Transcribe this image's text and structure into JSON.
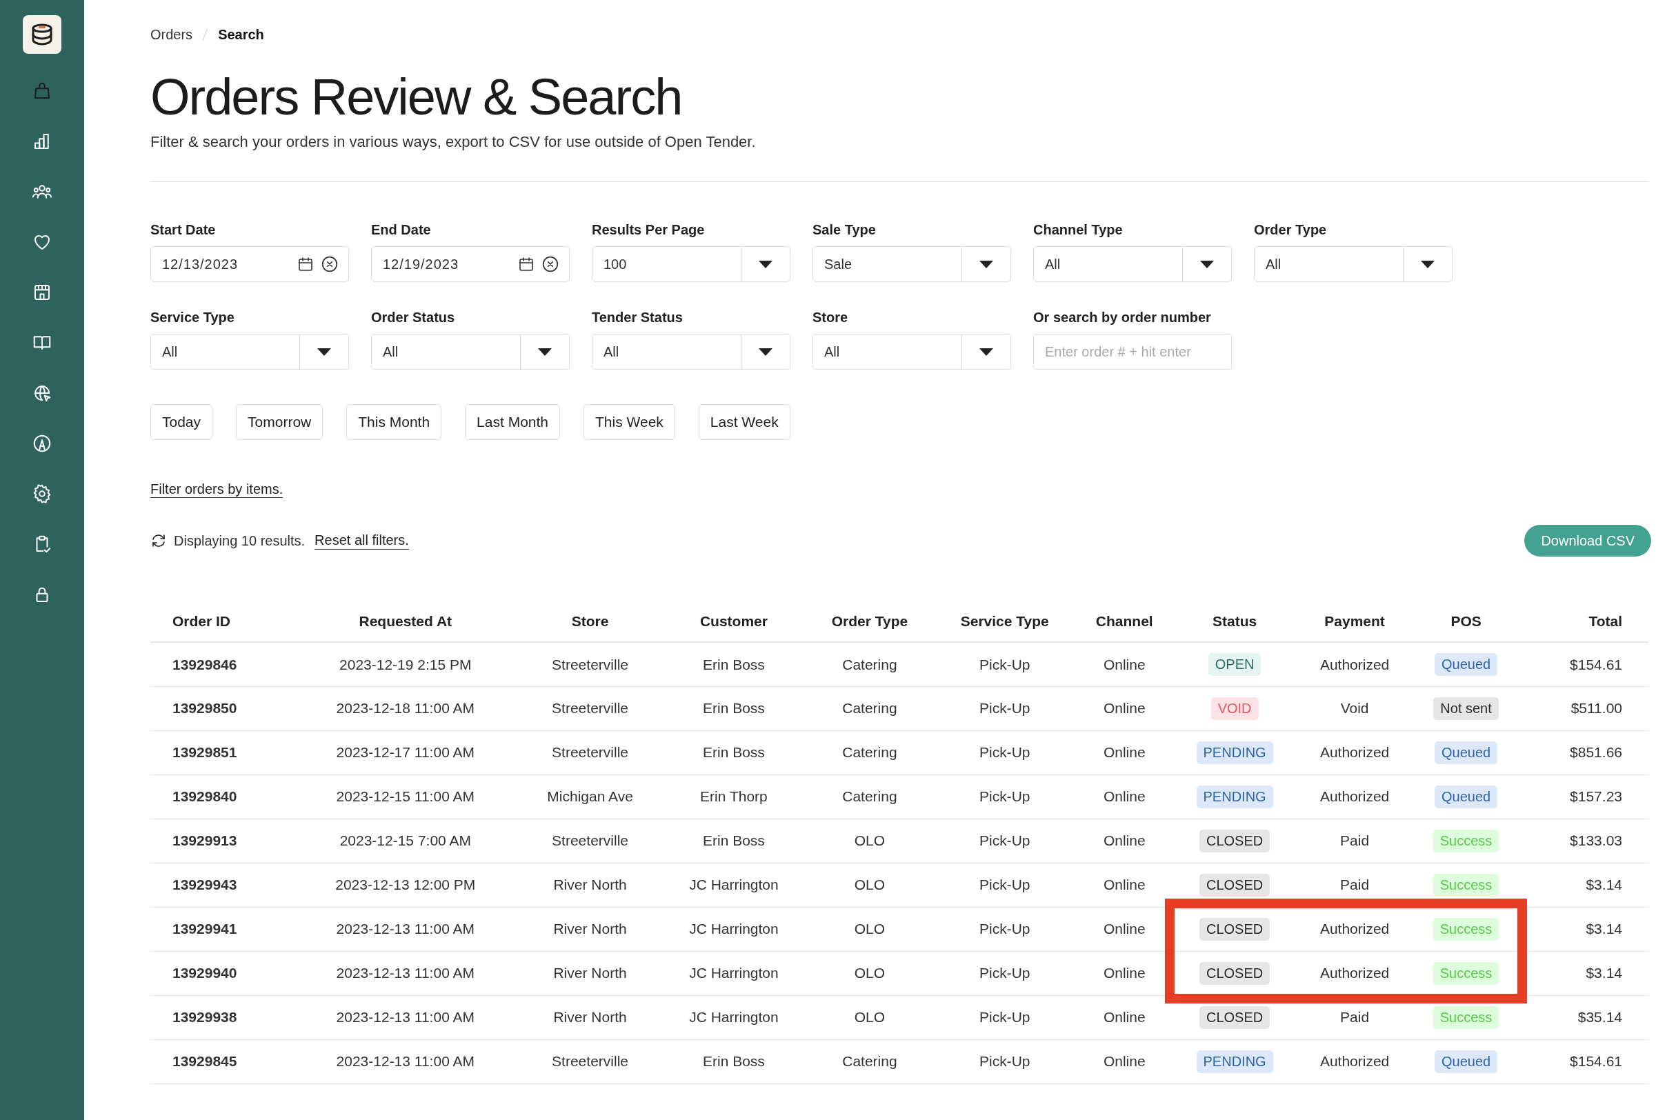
{
  "sidebar": {
    "items": [
      {
        "selected": false
      },
      {
        "selected": false
      },
      {
        "selected": false
      },
      {
        "selected": false
      },
      {
        "selected": false
      },
      {
        "selected": false
      },
      {
        "selected": false
      },
      {
        "selected": false
      },
      {
        "selected": false
      },
      {
        "selected": false
      },
      {
        "selected": false
      }
    ]
  },
  "breadcrumb": [
    {
      "label": "Orders",
      "current": false
    },
    {
      "label": "Search",
      "current": true
    }
  ],
  "title": "Orders Review & Search",
  "subtitle": "Filter & search your orders in various ways, export to CSV for use outside of Open Tender.",
  "filters": [
    {
      "kind": "date",
      "label": "Start Date",
      "value": "12/13/2023"
    },
    {
      "kind": "date",
      "label": "End Date",
      "value": "12/19/2023"
    },
    {
      "kind": "select",
      "label": "Results Per Page",
      "value": "100"
    },
    {
      "kind": "select",
      "label": "Sale Type",
      "value": "Sale"
    },
    {
      "kind": "select",
      "label": "Channel Type",
      "value": "All"
    },
    {
      "kind": "select",
      "label": "Order Type",
      "value": "All"
    },
    {
      "kind": "select",
      "label": "Service Type",
      "value": "All"
    },
    {
      "kind": "select",
      "label": "Order Status",
      "value": "All"
    },
    {
      "kind": "select",
      "label": "Tender Status",
      "value": "All"
    },
    {
      "kind": "select",
      "label": "Store",
      "value": "All"
    },
    {
      "kind": "text",
      "label": "Or search by order number",
      "placeholder": "Enter order # + hit enter"
    }
  ],
  "quick_ranges": [
    "Today",
    "Tomorrow",
    "This Month",
    "Last Month",
    "This Week",
    "Last Week"
  ],
  "filter_by_items_link": "Filter orders by items.",
  "results_text": "Displaying 10 results.",
  "reset_link": "Reset all filters.",
  "download_button": "Download CSV",
  "table": {
    "columns": [
      "Order ID",
      "Requested At",
      "Store",
      "Customer",
      "Order Type",
      "Service Type",
      "Channel",
      "Status",
      "Payment",
      "POS",
      "Total"
    ],
    "rows": [
      {
        "cells": [
          "13929846",
          "2023-12-19 2:15 PM",
          "Streeterville",
          "Erin Boss",
          "Catering",
          "Pick-Up",
          "Online"
        ],
        "status": {
          "text": "OPEN",
          "kind": "open"
        },
        "payment": "Authorized",
        "pos": {
          "text": "Queued",
          "kind": "queued"
        },
        "total": "$154.61",
        "highlighted": false
      },
      {
        "cells": [
          "13929850",
          "2023-12-18 11:00 AM",
          "Streeterville",
          "Erin Boss",
          "Catering",
          "Pick-Up",
          "Online"
        ],
        "status": {
          "text": "VOID",
          "kind": "void"
        },
        "payment": "Void",
        "pos": {
          "text": "Not sent",
          "kind": "not_sent"
        },
        "total": "$511.00",
        "highlighted": false
      },
      {
        "cells": [
          "13929851",
          "2023-12-17 11:00 AM",
          "Streeterville",
          "Erin Boss",
          "Catering",
          "Pick-Up",
          "Online"
        ],
        "status": {
          "text": "PENDING",
          "kind": "pending"
        },
        "payment": "Authorized",
        "pos": {
          "text": "Queued",
          "kind": "queued"
        },
        "total": "$851.66",
        "highlighted": false
      },
      {
        "cells": [
          "13929840",
          "2023-12-15 11:00 AM",
          "Michigan Ave",
          "Erin Thorp",
          "Catering",
          "Pick-Up",
          "Online"
        ],
        "status": {
          "text": "PENDING",
          "kind": "pending"
        },
        "payment": "Authorized",
        "pos": {
          "text": "Queued",
          "kind": "queued"
        },
        "total": "$157.23",
        "highlighted": false
      },
      {
        "cells": [
          "13929913",
          "2023-12-15 7:00 AM",
          "Streeterville",
          "Erin Boss",
          "OLO",
          "Pick-Up",
          "Online"
        ],
        "status": {
          "text": "CLOSED",
          "kind": "closed"
        },
        "payment": "Paid",
        "pos": {
          "text": "Success",
          "kind": "success"
        },
        "total": "$133.03",
        "highlighted": false
      },
      {
        "cells": [
          "13929943",
          "2023-12-13 12:00 PM",
          "River North",
          "JC Harrington",
          "OLO",
          "Pick-Up",
          "Online"
        ],
        "status": {
          "text": "CLOSED",
          "kind": "closed"
        },
        "payment": "Paid",
        "pos": {
          "text": "Success",
          "kind": "success"
        },
        "total": "$3.14",
        "highlighted": false
      },
      {
        "cells": [
          "13929941",
          "2023-12-13 11:00 AM",
          "River North",
          "JC Harrington",
          "OLO",
          "Pick-Up",
          "Online"
        ],
        "status": {
          "text": "CLOSED",
          "kind": "closed"
        },
        "payment": "Authorized",
        "pos": {
          "text": "Success",
          "kind": "success"
        },
        "total": "$3.14",
        "highlighted": true
      },
      {
        "cells": [
          "13929940",
          "2023-12-13 11:00 AM",
          "River North",
          "JC Harrington",
          "OLO",
          "Pick-Up",
          "Online"
        ],
        "status": {
          "text": "CLOSED",
          "kind": "closed"
        },
        "payment": "Authorized",
        "pos": {
          "text": "Success",
          "kind": "success"
        },
        "total": "$3.14",
        "highlighted": true
      },
      {
        "cells": [
          "13929938",
          "2023-12-13 11:00 AM",
          "River North",
          "JC Harrington",
          "OLO",
          "Pick-Up",
          "Online"
        ],
        "status": {
          "text": "CLOSED",
          "kind": "closed"
        },
        "payment": "Paid",
        "pos": {
          "text": "Success",
          "kind": "success"
        },
        "total": "$35.14",
        "highlighted": false
      },
      {
        "cells": [
          "13929845",
          "2023-12-13 11:00 AM",
          "Streeterville",
          "Erin Boss",
          "Catering",
          "Pick-Up",
          "Online"
        ],
        "status": {
          "text": "PENDING",
          "kind": "pending"
        },
        "payment": "Authorized",
        "pos": {
          "text": "Queued",
          "kind": "queued"
        },
        "total": "$154.61",
        "highlighted": false
      }
    ]
  }
}
